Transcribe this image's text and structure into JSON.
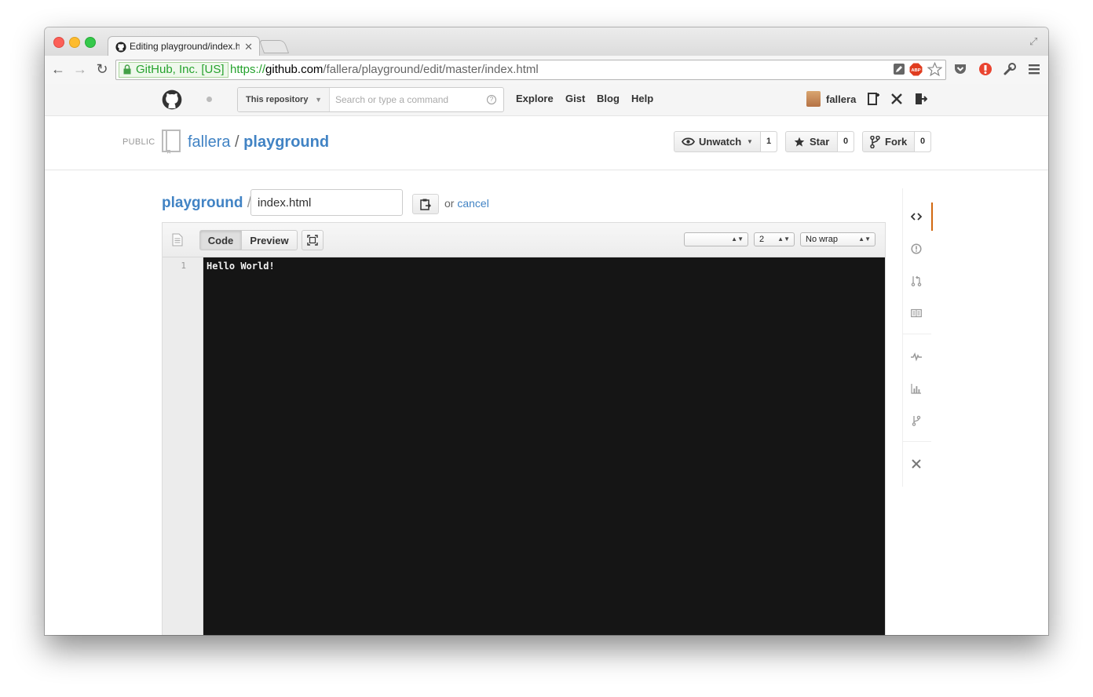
{
  "browser": {
    "tab_title": "Editing playground/index.h",
    "ev_label": "GitHub, Inc. [US]",
    "url_scheme": "https://",
    "url_host": "github.com",
    "url_path": "/fallera/playground/edit/master/index.html",
    "extension_icons": [
      "pencil-icon",
      "adblock-icon",
      "star-icon",
      "pocket-icon",
      "lastpass-icon",
      "wrench-icon",
      "menu-icon"
    ]
  },
  "gh_header": {
    "search_scope": "This repository",
    "search_placeholder": "Search or type a command",
    "help_glyph": "?",
    "nav": [
      "Explore",
      "Gist",
      "Blog",
      "Help"
    ],
    "username": "fallera"
  },
  "repo": {
    "visibility": "PUBLIC",
    "owner": "fallera",
    "separator": "/",
    "name": "playground",
    "unwatch_label": "Unwatch",
    "unwatch_count": "1",
    "star_label": "Star",
    "star_count": "0",
    "fork_label": "Fork",
    "fork_count": "0"
  },
  "editor": {
    "breadcrumb_root": "playground",
    "breadcrumb_sep": "/",
    "filename": "index.html",
    "or_text": "or",
    "cancel_label": "cancel",
    "code_tab": "Code",
    "preview_tab": "Preview",
    "indent_mode": "",
    "indent_size": "2",
    "wrap_mode": "No wrap",
    "lines": [
      {
        "number": "1",
        "text": "Hello World!"
      }
    ]
  },
  "colors": {
    "link": "#4183c4",
    "editor_bg": "#151515",
    "active_nav": "#d26911",
    "ev_green": "#25a22d"
  }
}
